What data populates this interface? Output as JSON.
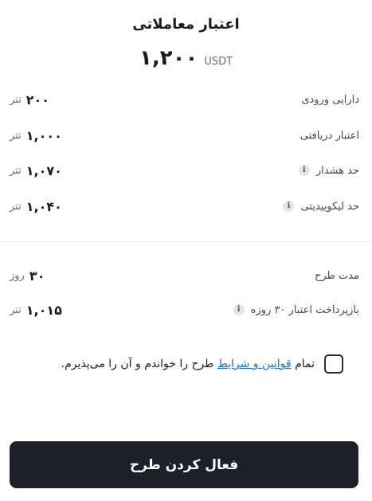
{
  "header": {
    "title": "اعتبار معاملاتی",
    "amount": "۱,۲۰۰",
    "currency": "USDT"
  },
  "details": [
    {
      "label": "دارایی ورودی",
      "value": "۲۰۰",
      "unit": "تتر",
      "info": false
    },
    {
      "label": "اعتبار دریافتی",
      "value": "۱,۰۰۰",
      "unit": "تتر",
      "info": false
    },
    {
      "label": "حد هشدار",
      "value": "۱,۰۷۰",
      "unit": "تتر",
      "info": true
    },
    {
      "label": "حد لیکوییدیتی",
      "value": "۱,۰۴۰",
      "unit": "تتر",
      "info": true
    }
  ],
  "plan": [
    {
      "label": "مدت طرح",
      "value": "۳۰",
      "unit": "روز",
      "info": false
    },
    {
      "label": "بازپرداخت اعتبار ۳۰ روزه",
      "value": "۱,۰۱۵",
      "unit": "تتر",
      "info": true
    }
  ],
  "info_icon_glyph": "i",
  "terms": {
    "prefix": "تمام",
    "link": "قوانین و شرایط",
    "suffix": "طرح را خواندم و آن را می‌پذیرم.",
    "checked": false
  },
  "cta": {
    "label": "فعال کردن طرح"
  },
  "colors": {
    "primary_dark": "#1d2029",
    "link": "#1a6fd8",
    "muted": "#666b78"
  }
}
